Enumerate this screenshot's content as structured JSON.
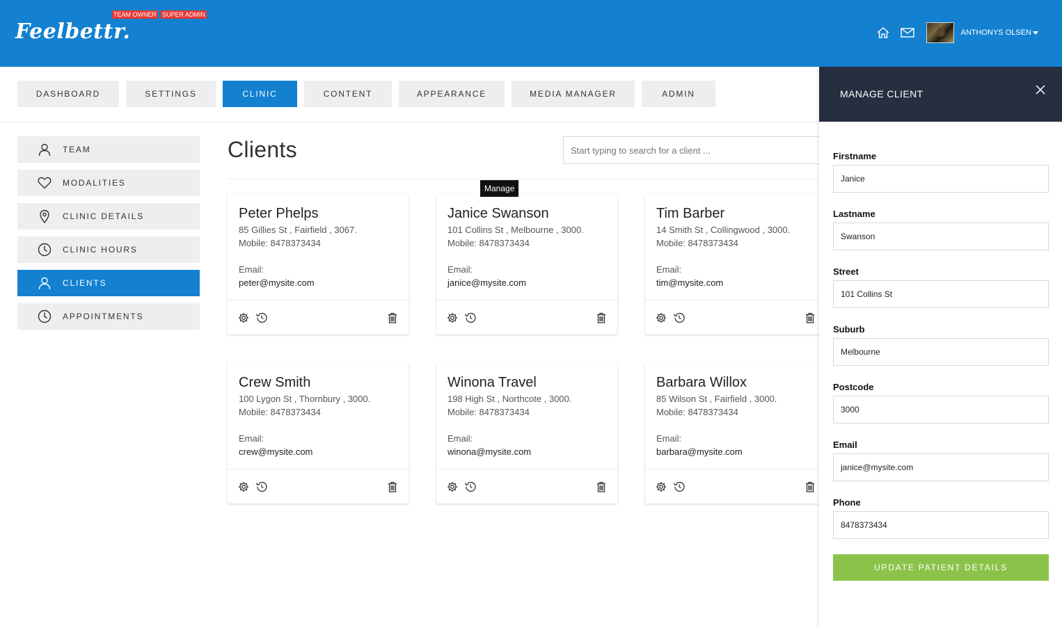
{
  "header": {
    "logo_text": "Feelbettr.",
    "badges": [
      "TEAM OWNER",
      "SUPER ADMIN"
    ],
    "user_name": "ANTHONYS OLSEN",
    "accent": "#1380d0"
  },
  "nav": [
    {
      "label": "DASHBOARD",
      "active": false
    },
    {
      "label": "SETTINGS",
      "active": false
    },
    {
      "label": "CLINIC",
      "active": true
    },
    {
      "label": "CONTENT",
      "active": false
    },
    {
      "label": "APPEARANCE",
      "active": false
    },
    {
      "label": "MEDIA MANAGER",
      "active": false
    },
    {
      "label": "ADMIN",
      "active": false
    }
  ],
  "sidebar": [
    {
      "label": "TEAM",
      "icon": "user-icon"
    },
    {
      "label": "MODALITIES",
      "icon": "heart-icon"
    },
    {
      "label": "CLINIC DETAILS",
      "icon": "location-pin-icon"
    },
    {
      "label": "CLINIC HOURS",
      "icon": "clock-icon"
    },
    {
      "label": "CLIENTS",
      "icon": "user-icon",
      "active": true
    },
    {
      "label": "APPOINTMENTS",
      "icon": "clock-icon"
    }
  ],
  "main": {
    "title": "Clients",
    "search_placeholder": "Start typing to search for a client ...",
    "tooltip": "Manage",
    "email_label": "Email:"
  },
  "clients": [
    {
      "name": "Peter Phelps",
      "address": "85 Gillies St , Fairfield , 3067.",
      "mobile": "Mobile: 8478373434",
      "email": "peter@mysite.com"
    },
    {
      "name": "Janice Swanson",
      "address": "101 Collins St , Melbourne , 3000.",
      "mobile": "Mobile: 8478373434",
      "email": "janice@mysite.com"
    },
    {
      "name": "Tim Barber",
      "address": "14 Smith St , Collingwood , 3000.",
      "mobile": "Mobile: 8478373434",
      "email": "tim@mysite.com"
    },
    {
      "name": "Crew Smith",
      "address": "100 Lygon St , Thornbury , 3000.",
      "mobile": "Mobile: 8478373434",
      "email": "crew@mysite.com"
    },
    {
      "name": "Winona Travel",
      "address": "198 High St , Northcote , 3000.",
      "mobile": "Mobile: 8478373434",
      "email": "winona@mysite.com"
    },
    {
      "name": "Barbara Willox",
      "address": "85 Wilson St , Fairfield , 3000.",
      "mobile": "Mobile: 8478373434",
      "email": "barbara@mysite.com"
    }
  ],
  "panel": {
    "title": "MANAGE CLIENT",
    "fields": [
      {
        "label": "Firstname",
        "value": "Janice"
      },
      {
        "label": "Lastname",
        "value": "Swanson"
      },
      {
        "label": "Street",
        "value": "101 Collins St"
      },
      {
        "label": "Suburb",
        "value": "Melbourne"
      },
      {
        "label": "Postcode",
        "value": "3000"
      },
      {
        "label": "Email",
        "value": "janice@mysite.com"
      },
      {
        "label": "Phone",
        "value": "8478373434"
      }
    ],
    "submit_label": "UPDATE PATIENT DETAILS",
    "submit_color": "#8bc34a"
  }
}
